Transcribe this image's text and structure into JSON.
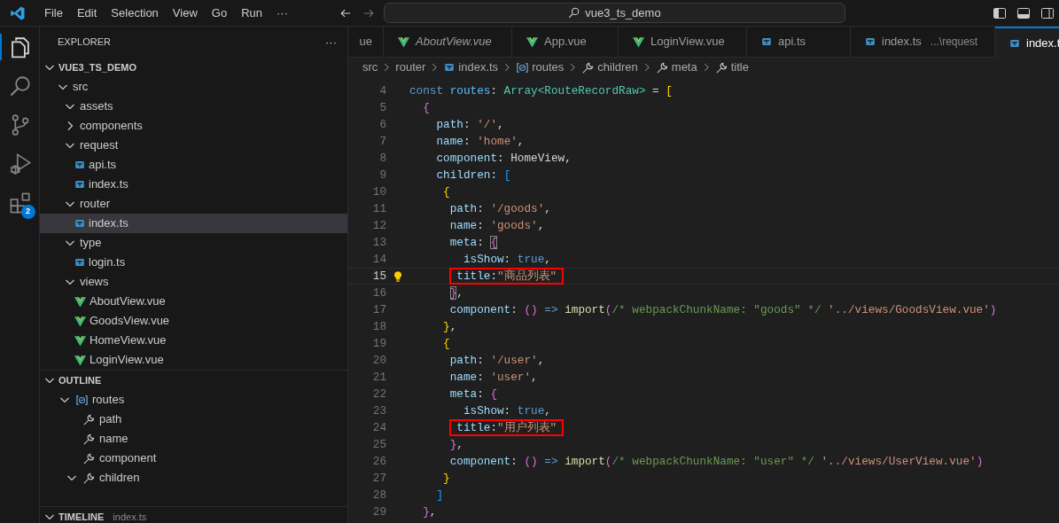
{
  "menu": [
    "File",
    "Edit",
    "Selection",
    "View",
    "Go",
    "Run",
    "···"
  ],
  "command_center": {
    "value": "vue3_ts_demo"
  },
  "activity_bar": [
    {
      "kind": "files",
      "selected": true
    },
    {
      "kind": "search",
      "selected": false
    },
    {
      "kind": "source-control",
      "selected": false
    },
    {
      "kind": "run-debug",
      "selected": false
    },
    {
      "kind": "extensions",
      "selected": false,
      "badge": "2"
    }
  ],
  "sidebar": {
    "title": "EXPLORER",
    "more": "···",
    "explorer": {
      "label": "VUE3_TS_DEMO",
      "expanded": true,
      "children": [
        {
          "label": "src",
          "kind": "folder",
          "expanded": true,
          "selected": false,
          "children": [
            {
              "label": "assets",
              "kind": "folder",
              "expanded": true,
              "selected": false
            },
            {
              "label": "components",
              "kind": "folder",
              "expanded": false,
              "selected": false
            },
            {
              "label": "request",
              "kind": "folder",
              "expanded": true,
              "selected": false,
              "children": [
                {
                  "label": "api.ts",
                  "kind": "ts",
                  "selected": false
                },
                {
                  "label": "index.ts",
                  "kind": "ts",
                  "selected": false
                }
              ]
            },
            {
              "label": "router",
              "kind": "folder",
              "expanded": true,
              "selected": false,
              "children": [
                {
                  "label": "index.ts",
                  "kind": "ts",
                  "selected": true
                }
              ]
            },
            {
              "label": "type",
              "kind": "folder",
              "expanded": true,
              "selected": false,
              "children": [
                {
                  "label": "login.ts",
                  "kind": "ts",
                  "selected": false
                }
              ]
            },
            {
              "label": "views",
              "kind": "folder",
              "expanded": true,
              "selected": false,
              "children": [
                {
                  "label": "AboutView.vue",
                  "kind": "vue",
                  "selected": false
                },
                {
                  "label": "GoodsView.vue",
                  "kind": "vue",
                  "selected": false
                },
                {
                  "label": "HomeView.vue",
                  "kind": "vue",
                  "selected": false
                },
                {
                  "label": "LoginView.vue",
                  "kind": "vue",
                  "selected": false
                }
              ]
            }
          ]
        }
      ]
    },
    "outline": {
      "label": "OUTLINE",
      "expanded": true,
      "children": [
        {
          "label": "routes",
          "kind": "variable",
          "expanded": true,
          "children": [
            {
              "label": "path",
              "kind": "property"
            },
            {
              "label": "name",
              "kind": "property"
            },
            {
              "label": "component",
              "kind": "property"
            },
            {
              "label": "children",
              "kind": "property",
              "expanded": true
            }
          ]
        }
      ]
    },
    "timeline": {
      "label": "TIMELINE",
      "description": "index.ts",
      "expanded": true
    }
  },
  "tabs": [
    {
      "label": "ue",
      "italic": false,
      "selected": false
    },
    {
      "label": "AboutView.vue",
      "kind": "vue",
      "italic": true,
      "selected": false
    },
    {
      "label": "App.vue",
      "kind": "vue",
      "italic": false,
      "selected": false
    },
    {
      "label": "LoginView.vue",
      "kind": "vue",
      "italic": false,
      "selected": false
    },
    {
      "label": "api.ts",
      "kind": "ts",
      "italic": false,
      "selected": false
    },
    {
      "label": "index.ts",
      "kind": "ts",
      "italic": false,
      "selected": false,
      "description": "...\\request"
    },
    {
      "label": "index.t",
      "kind": "ts",
      "italic": false,
      "selected": true
    }
  ],
  "breadcrumb": [
    {
      "label": "src",
      "kind": "folder"
    },
    {
      "label": "router",
      "kind": "folder"
    },
    {
      "label": "index.ts",
      "kind": "ts"
    },
    {
      "label": "routes",
      "kind": "variable"
    },
    {
      "label": "children",
      "kind": "property"
    },
    {
      "label": "meta",
      "kind": "property"
    },
    {
      "label": "title",
      "kind": "property"
    }
  ],
  "editor": {
    "lines": [
      {
        "number": "4",
        "active": false,
        "boxed": false,
        "tokens": [
          {
            "text": "const ",
            "kind": "keyword"
          },
          {
            "text": "routes",
            "kind": "constant"
          },
          {
            "text": ": ",
            "kind": "plain"
          },
          {
            "text": "Array<RouteRecordRaw>",
            "kind": "type"
          },
          {
            "text": " = ",
            "kind": "plain"
          },
          {
            "text": "[",
            "kind": "bracket1"
          }
        ]
      },
      {
        "number": "5",
        "active": false,
        "boxed": false,
        "tokens": [
          {
            "text": "  {",
            "kind": "bracket2"
          }
        ]
      },
      {
        "number": "6",
        "active": false,
        "boxed": false,
        "tokens": [
          {
            "text": "    path",
            "kind": "property"
          },
          {
            "text": ": ",
            "kind": "plain"
          },
          {
            "text": "'/'",
            "kind": "string"
          },
          {
            "text": ",",
            "kind": "plain"
          }
        ]
      },
      {
        "number": "7",
        "active": false,
        "boxed": false,
        "tokens": [
          {
            "text": "    name",
            "kind": "property"
          },
          {
            "text": ": ",
            "kind": "plain"
          },
          {
            "text": "'home'",
            "kind": "string"
          },
          {
            "text": ",",
            "kind": "plain"
          }
        ]
      },
      {
        "number": "8",
        "active": false,
        "boxed": false,
        "tokens": [
          {
            "text": "    component",
            "kind": "property"
          },
          {
            "text": ": HomeView,",
            "kind": "plain"
          }
        ]
      },
      {
        "number": "9",
        "active": false,
        "boxed": false,
        "tokens": [
          {
            "text": "    children",
            "kind": "property"
          },
          {
            "text": ": ",
            "kind": "plain"
          },
          {
            "text": "[",
            "kind": "bracket3"
          }
        ]
      },
      {
        "number": "10",
        "active": false,
        "boxed": false,
        "tokens": [
          {
            "text": "     {",
            "kind": "bracket1"
          }
        ]
      },
      {
        "number": "11",
        "active": false,
        "boxed": false,
        "tokens": [
          {
            "text": "      path",
            "kind": "property"
          },
          {
            "text": ": ",
            "kind": "plain"
          },
          {
            "text": "'/goods'",
            "kind": "string"
          },
          {
            "text": ",",
            "kind": "plain"
          }
        ]
      },
      {
        "number": "12",
        "active": false,
        "boxed": false,
        "tokens": [
          {
            "text": "      name",
            "kind": "property"
          },
          {
            "text": ": ",
            "kind": "plain"
          },
          {
            "text": "'goods'",
            "kind": "string"
          },
          {
            "text": ",",
            "kind": "plain"
          }
        ]
      },
      {
        "number": "13",
        "active": false,
        "boxed": false,
        "tokens": [
          {
            "text": "      meta",
            "kind": "property"
          },
          {
            "text": ": ",
            "kind": "plain"
          },
          {
            "text": "{",
            "kind": "bracket2-matched"
          }
        ]
      },
      {
        "number": "14",
        "active": false,
        "boxed": false,
        "tokens": [
          {
            "text": "        isShow",
            "kind": "property"
          },
          {
            "text": ": ",
            "kind": "plain"
          },
          {
            "text": "true",
            "kind": "keyword"
          },
          {
            "text": ",",
            "kind": "plain"
          }
        ]
      },
      {
        "number": "15",
        "active": true,
        "boxed": true,
        "tokens": [
          {
            "text": "        title",
            "kind": "property"
          },
          {
            "text": ":",
            "kind": "plain"
          },
          {
            "text": "\"商品列表\"",
            "kind": "string"
          }
        ]
      },
      {
        "number": "16",
        "active": false,
        "boxed": false,
        "tokens": [
          {
            "text": "      }",
            "kind": "bracket2-matched"
          },
          {
            "text": ",",
            "kind": "plain"
          }
        ]
      },
      {
        "number": "17",
        "active": false,
        "boxed": false,
        "tokens": [
          {
            "text": "      component",
            "kind": "property"
          },
          {
            "text": ": ",
            "kind": "plain"
          },
          {
            "text": "()",
            "kind": "bracket2"
          },
          {
            "text": " => ",
            "kind": "keyword"
          },
          {
            "text": "import",
            "kind": "function"
          },
          {
            "text": "(",
            "kind": "bracket2"
          },
          {
            "text": "/* webpackChunkName: \"goods\" */",
            "kind": "comment"
          },
          {
            "text": " '../views/GoodsView.vue'",
            "kind": "string"
          },
          {
            "text": ")",
            "kind": "bracket2"
          }
        ]
      },
      {
        "number": "18",
        "active": false,
        "boxed": false,
        "tokens": [
          {
            "text": "     }",
            "kind": "bracket1"
          },
          {
            "text": ",",
            "kind": "plain"
          }
        ]
      },
      {
        "number": "19",
        "active": false,
        "boxed": false,
        "tokens": [
          {
            "text": "     {",
            "kind": "bracket1"
          }
        ]
      },
      {
        "number": "20",
        "active": false,
        "boxed": false,
        "tokens": [
          {
            "text": "      path",
            "kind": "property"
          },
          {
            "text": ": ",
            "kind": "plain"
          },
          {
            "text": "'/user'",
            "kind": "string"
          },
          {
            "text": ",",
            "kind": "plain"
          }
        ]
      },
      {
        "number": "21",
        "active": false,
        "boxed": false,
        "tokens": [
          {
            "text": "      name",
            "kind": "property"
          },
          {
            "text": ": ",
            "kind": "plain"
          },
          {
            "text": "'user'",
            "kind": "string"
          },
          {
            "text": ",",
            "kind": "plain"
          }
        ]
      },
      {
        "number": "22",
        "active": false,
        "boxed": false,
        "tokens": [
          {
            "text": "      meta",
            "kind": "property"
          },
          {
            "text": ": ",
            "kind": "plain"
          },
          {
            "text": "{",
            "kind": "bracket2"
          }
        ]
      },
      {
        "number": "23",
        "active": false,
        "boxed": false,
        "tokens": [
          {
            "text": "        isShow",
            "kind": "property"
          },
          {
            "text": ": ",
            "kind": "plain"
          },
          {
            "text": "true",
            "kind": "keyword"
          },
          {
            "text": ",",
            "kind": "plain"
          }
        ]
      },
      {
        "number": "24",
        "active": false,
        "boxed": true,
        "tokens": [
          {
            "text": "        title",
            "kind": "property"
          },
          {
            "text": ":",
            "kind": "plain"
          },
          {
            "text": "\"用户列表\"",
            "kind": "string"
          }
        ]
      },
      {
        "number": "25",
        "active": false,
        "boxed": false,
        "tokens": [
          {
            "text": "      }",
            "kind": "bracket2"
          },
          {
            "text": ",",
            "kind": "plain"
          }
        ]
      },
      {
        "number": "26",
        "active": false,
        "boxed": false,
        "tokens": [
          {
            "text": "      component",
            "kind": "property"
          },
          {
            "text": ": ",
            "kind": "plain"
          },
          {
            "text": "()",
            "kind": "bracket2"
          },
          {
            "text": " => ",
            "kind": "keyword"
          },
          {
            "text": "import",
            "kind": "function"
          },
          {
            "text": "(",
            "kind": "bracket2"
          },
          {
            "text": "/* webpackChunkName: \"user\" */",
            "kind": "comment"
          },
          {
            "text": " '../views/UserView.vue'",
            "kind": "string"
          },
          {
            "text": ")",
            "kind": "bracket2"
          }
        ]
      },
      {
        "number": "27",
        "active": false,
        "boxed": false,
        "tokens": [
          {
            "text": "     }",
            "kind": "bracket1"
          }
        ]
      },
      {
        "number": "28",
        "active": false,
        "boxed": false,
        "tokens": [
          {
            "text": "    ]",
            "kind": "bracket3"
          }
        ]
      },
      {
        "number": "29",
        "active": false,
        "boxed": false,
        "tokens": [
          {
            "text": "  }",
            "kind": "bracket2"
          },
          {
            "text": ",",
            "kind": "plain"
          }
        ]
      }
    ]
  }
}
